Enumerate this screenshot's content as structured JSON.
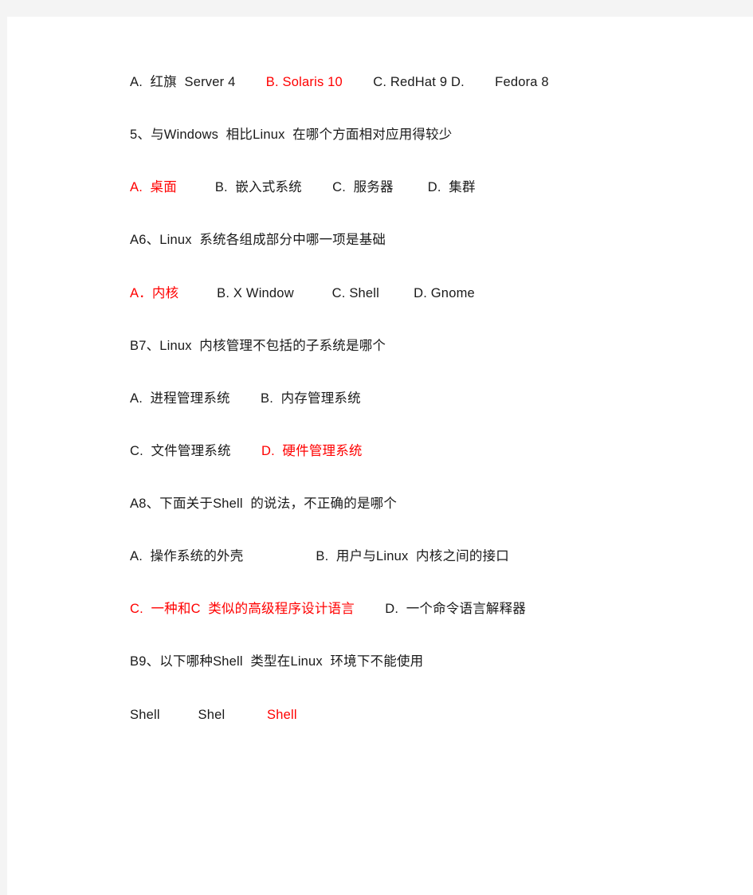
{
  "document": {
    "page_background": "#f4f4f4",
    "sheet_background": "#ffffff",
    "answer_color": "#ff0000",
    "text_color": "#1a1a1a",
    "lines": [
      {
        "name": "q4-options",
        "runs": [
          {
            "text": "A.  红旗  Server 4",
            "color": "black"
          },
          {
            "text": "        ",
            "color": "black"
          },
          {
            "text": "B. Solaris 10",
            "color": "red"
          },
          {
            "text": "        ",
            "color": "black"
          },
          {
            "text": "C. RedHat 9 D.        Fedora 8",
            "color": "black"
          }
        ]
      },
      {
        "name": "q5-stem",
        "runs": [
          {
            "text": "5、与Windows  相比Linux  在哪个方面相对应用得较少",
            "color": "black"
          }
        ]
      },
      {
        "name": "q5-options",
        "runs": [
          {
            "text": "A.  桌面",
            "color": "red"
          },
          {
            "text": "          ",
            "color": "black"
          },
          {
            "text": "B.  嵌入式系统",
            "color": "black"
          },
          {
            "text": "        ",
            "color": "black"
          },
          {
            "text": "C.  服务器",
            "color": "black"
          },
          {
            "text": "         ",
            "color": "black"
          },
          {
            "text": "D.  集群",
            "color": "black"
          }
        ]
      },
      {
        "name": "q6-stem",
        "runs": [
          {
            "text": "A6、Linux  系统各组成部分中哪一项是基础",
            "color": "black"
          }
        ]
      },
      {
        "name": "q6-options",
        "runs": [
          {
            "text": "A．内核",
            "color": "red"
          },
          {
            "text": "          ",
            "color": "black"
          },
          {
            "text": "B. X Window",
            "color": "black"
          },
          {
            "text": "          ",
            "color": "black"
          },
          {
            "text": "C. Shell",
            "color": "black"
          },
          {
            "text": "         ",
            "color": "black"
          },
          {
            "text": "D. Gnome",
            "color": "black"
          }
        ]
      },
      {
        "name": "q7-stem",
        "runs": [
          {
            "text": "B7、Linux  内核管理不包括的子系统是哪个",
            "color": "black"
          }
        ]
      },
      {
        "name": "q7-options-ab",
        "runs": [
          {
            "text": "A.  进程管理系统",
            "color": "black"
          },
          {
            "text": "        ",
            "color": "black"
          },
          {
            "text": "B.  内存管理系统",
            "color": "black"
          }
        ]
      },
      {
        "name": "q7-options-cd",
        "runs": [
          {
            "text": "C.  文件管理系统",
            "color": "black"
          },
          {
            "text": "        ",
            "color": "black"
          },
          {
            "text": "D.  硬件管理系统",
            "color": "red"
          }
        ]
      },
      {
        "name": "q8-stem",
        "runs": [
          {
            "text": "A8、下面关于Shell  的说法，不正确的是哪个",
            "color": "black"
          }
        ]
      },
      {
        "name": "q8-options-ab",
        "runs": [
          {
            "text": "A.  操作系统的外壳",
            "color": "black"
          },
          {
            "text": "                   ",
            "color": "black"
          },
          {
            "text": "B.  用户与Linux  内核之间的接口",
            "color": "black"
          }
        ]
      },
      {
        "name": "q8-options-cd",
        "runs": [
          {
            "text": "C.  一种和C  类似的高级程序设计语言",
            "color": "red"
          },
          {
            "text": "        ",
            "color": "black"
          },
          {
            "text": "D.  一个命令语言解释器",
            "color": "black"
          }
        ]
      },
      {
        "name": "q9-stem",
        "runs": [
          {
            "text": "B9、以下哪种Shell  类型在Linux  环境下不能使用",
            "color": "black"
          }
        ]
      },
      {
        "name": "q9-options",
        "runs": [
          {
            "text": "Shell",
            "color": "black"
          },
          {
            "text": "          ",
            "color": "black"
          },
          {
            "text": "Shel",
            "color": "black"
          },
          {
            "text": "           ",
            "color": "black"
          },
          {
            "text": "Shell",
            "color": "red"
          }
        ]
      }
    ]
  }
}
